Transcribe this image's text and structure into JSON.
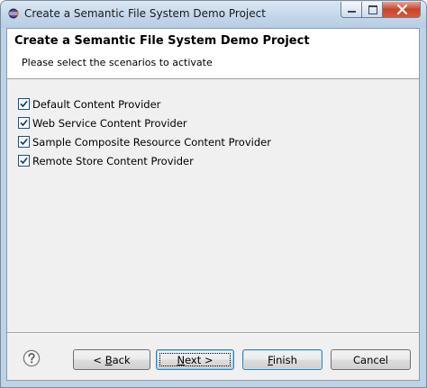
{
  "window": {
    "title": "Create a Semantic File System Demo Project",
    "controls": {
      "minimize_icon": "minimize-icon",
      "maximize_icon": "maximize-icon",
      "close_icon": "close-icon"
    }
  },
  "header": {
    "title": "Create a Semantic File System Demo Project",
    "description": "Please select the scenarios to activate"
  },
  "scenarios": [
    {
      "label": "Default Content Provider",
      "checked": true
    },
    {
      "label": "Web Service Content Provider",
      "checked": true
    },
    {
      "label": "Sample Composite Resource Content Provider",
      "checked": true
    },
    {
      "label": "Remote Store Content Provider",
      "checked": true
    }
  ],
  "footer": {
    "help_icon": "help-icon",
    "back": {
      "prefix": "< ",
      "mnemonic": "B",
      "rest": "ack"
    },
    "next": {
      "mnemonic": "N",
      "rest": "ext >"
    },
    "finish": {
      "mnemonic": "F",
      "rest": "inish"
    },
    "cancel": {
      "label": "Cancel"
    }
  },
  "colors": {
    "accent": "#3c7fb1",
    "close_button": "#c7452a",
    "checkmark": "#1a3a6b"
  }
}
